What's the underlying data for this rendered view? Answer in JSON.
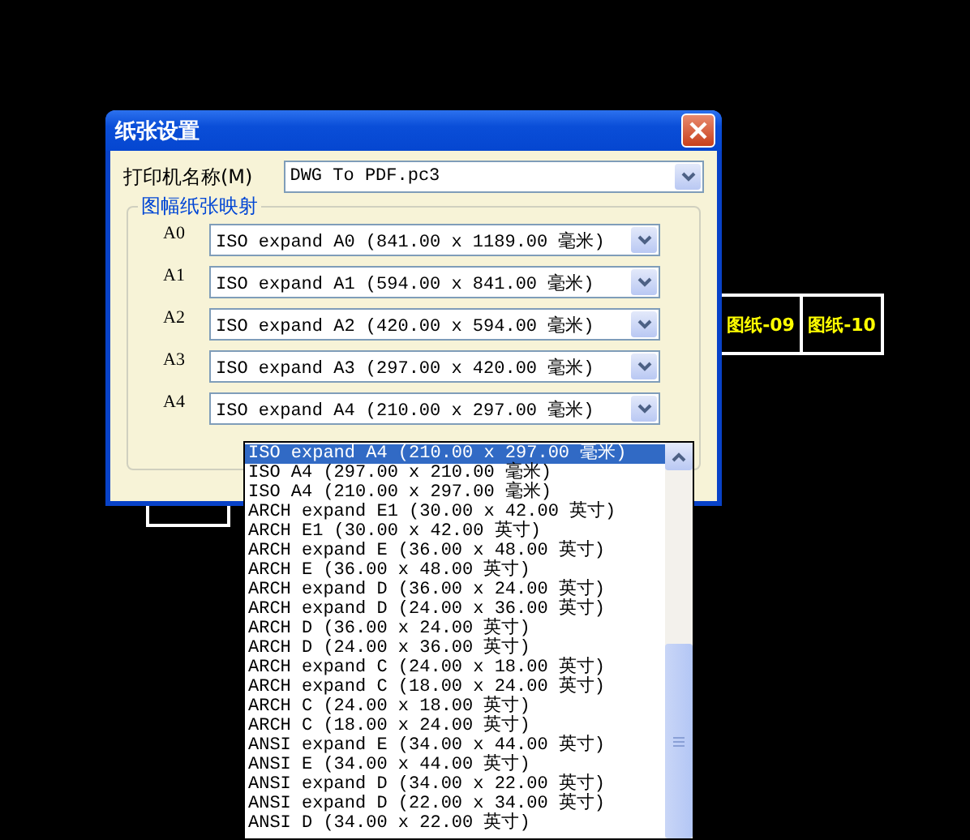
{
  "canvas": {
    "sheet_labels": [
      "图纸-09",
      "图纸-10"
    ]
  },
  "dialog": {
    "title": "纸张设置",
    "printer": {
      "label": "打印机名称(M)",
      "value": "DWG To PDF.pc3"
    },
    "group_title": "图幅纸张映射",
    "mappings": [
      {
        "label": "A0",
        "value": "ISO expand A0 (841.00 x 1189.00 毫米)"
      },
      {
        "label": "A1",
        "value": "ISO expand A1 (594.00 x 841.00 毫米)"
      },
      {
        "label": "A2",
        "value": "ISO expand A2 (420.00 x 594.00 毫米)"
      },
      {
        "label": "A3",
        "value": "ISO expand A3 (297.00 x 420.00 毫米)"
      },
      {
        "label": "A4",
        "value": "ISO expand A4 (210.00 x 297.00 毫米)"
      }
    ],
    "dropdown": [
      {
        "text": "ISO expand A4 (210.00 x 297.00 毫米)",
        "selected": true
      },
      {
        "text": "ISO A4 (297.00 x 210.00 毫米)",
        "selected": false
      },
      {
        "text": "ISO A4 (210.00 x 297.00 毫米)",
        "selected": false
      },
      {
        "text": "ARCH expand E1 (30.00 x 42.00 英寸)",
        "selected": false
      },
      {
        "text": "ARCH E1 (30.00 x 42.00 英寸)",
        "selected": false
      },
      {
        "text": "ARCH expand E (36.00 x 48.00 英寸)",
        "selected": false
      },
      {
        "text": "ARCH E (36.00 x 48.00 英寸)",
        "selected": false
      },
      {
        "text": "ARCH expand D (36.00 x 24.00 英寸)",
        "selected": false
      },
      {
        "text": "ARCH expand D (24.00 x 36.00 英寸)",
        "selected": false
      },
      {
        "text": "ARCH D (36.00 x 24.00 英寸)",
        "selected": false
      },
      {
        "text": "ARCH D (24.00 x 36.00 英寸)",
        "selected": false
      },
      {
        "text": "ARCH expand C (24.00 x 18.00 英寸)",
        "selected": false
      },
      {
        "text": "ARCH expand C (18.00 x 24.00 英寸)",
        "selected": false
      },
      {
        "text": "ARCH C (24.00 x 18.00 英寸)",
        "selected": false
      },
      {
        "text": "ARCH C (18.00 x 24.00 英寸)",
        "selected": false
      },
      {
        "text": "ANSI expand E (34.00 x 44.00 英寸)",
        "selected": false
      },
      {
        "text": "ANSI E (34.00 x 44.00 英寸)",
        "selected": false
      },
      {
        "text": "ANSI expand D (34.00 x 22.00 英寸)",
        "selected": false
      },
      {
        "text": "ANSI expand D (22.00 x 34.00 英寸)",
        "selected": false
      },
      {
        "text": "ANSI D (34.00 x 22.00 英寸)",
        "selected": false
      }
    ]
  }
}
